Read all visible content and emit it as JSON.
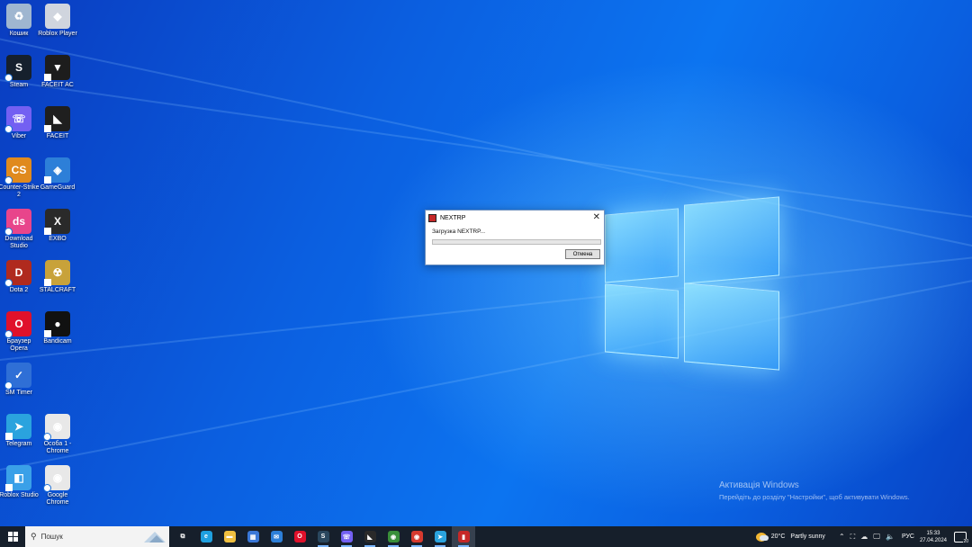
{
  "desktop": {
    "icons": [
      {
        "label": "Кошик",
        "color": "#9fb6d0",
        "glyph": "♻"
      },
      {
        "label": "Roblox Player",
        "color": "#d0d5de",
        "glyph": "◆"
      },
      {
        "label": "Steam",
        "color": "#16202d",
        "glyph": "S"
      },
      {
        "label": "FACEIT AC",
        "color": "#1d1d1d",
        "glyph": "▼"
      },
      {
        "label": "Viber",
        "color": "#7360f2",
        "glyph": "☏"
      },
      {
        "label": "FACEIT",
        "color": "#1f1f1f",
        "glyph": "◣"
      },
      {
        "label": "Counter-Strike 2",
        "color": "#e08a1e",
        "glyph": "CS"
      },
      {
        "label": "GameGuard",
        "color": "#2d7fd8",
        "glyph": "◈"
      },
      {
        "label": "Download Studio",
        "color": "#e8458b",
        "glyph": "ds"
      },
      {
        "label": "EXBO",
        "color": "#2a2a2a",
        "glyph": "X"
      },
      {
        "label": "Dota 2",
        "color": "#b02a1e",
        "glyph": "D"
      },
      {
        "label": "STALCRAFT",
        "color": "#c8a23a",
        "glyph": "☢"
      },
      {
        "label": "Браузер Opera",
        "color": "#e0112b",
        "glyph": "O"
      },
      {
        "label": "Bandicam",
        "color": "#111111",
        "glyph": "●"
      },
      {
        "label": "SM Timer",
        "color": "#2f6fd6",
        "glyph": "✓"
      },
      {
        "label": "Telegram",
        "color": "#2aa3de",
        "glyph": "➤"
      },
      {
        "label": "Особа 1 - Chrome",
        "color": "#e8e8e8",
        "glyph": "◉"
      },
      {
        "label": "Roblox Studio",
        "color": "#3aa0e8",
        "glyph": "◧"
      },
      {
        "label": "Google Chrome",
        "color": "#e8e8e8",
        "glyph": "◉"
      }
    ]
  },
  "dialog": {
    "title": "NEXTRP",
    "close_glyph": "✕",
    "message": "Загрузка NEXTRP...",
    "progress": 0,
    "cancel_label": "Отмена"
  },
  "watermark": {
    "title": "Активація Windows",
    "subtitle": "Перейдіть до розділу \"Настройки\", щоб активувати Windows."
  },
  "taskbar": {
    "search_placeholder": "Пошук",
    "apps": [
      {
        "name": "task-view",
        "glyph": "⧉",
        "color": "#161f2b"
      },
      {
        "name": "edge",
        "glyph": "e",
        "color": "#1fa0e0"
      },
      {
        "name": "file-explorer",
        "glyph": "▬",
        "color": "#f0c040"
      },
      {
        "name": "microsoft-store",
        "glyph": "▦",
        "color": "#3a78d8"
      },
      {
        "name": "mail",
        "glyph": "✉",
        "color": "#2d7fd8"
      },
      {
        "name": "opera",
        "glyph": "O",
        "color": "#e0112b"
      },
      {
        "name": "steam",
        "glyph": "S",
        "color": "#2a475e"
      },
      {
        "name": "viber",
        "glyph": "☏",
        "color": "#7360f2"
      },
      {
        "name": "faceit",
        "glyph": "◣",
        "color": "#2a2a2a"
      },
      {
        "name": "chrome-profile",
        "glyph": "◉",
        "color": "#3a8f3a"
      },
      {
        "name": "chrome",
        "glyph": "◉",
        "color": "#d63a2f"
      },
      {
        "name": "telegram",
        "glyph": "➤",
        "color": "#2aa3de"
      },
      {
        "name": "nextrp",
        "glyph": "▮",
        "color": "#c62828"
      }
    ],
    "weather": {
      "temp": "20°C",
      "desc": "Partly sunny"
    },
    "language": "РУС",
    "time": "15:33",
    "date": "27.04.2024",
    "notification_count": "20"
  }
}
